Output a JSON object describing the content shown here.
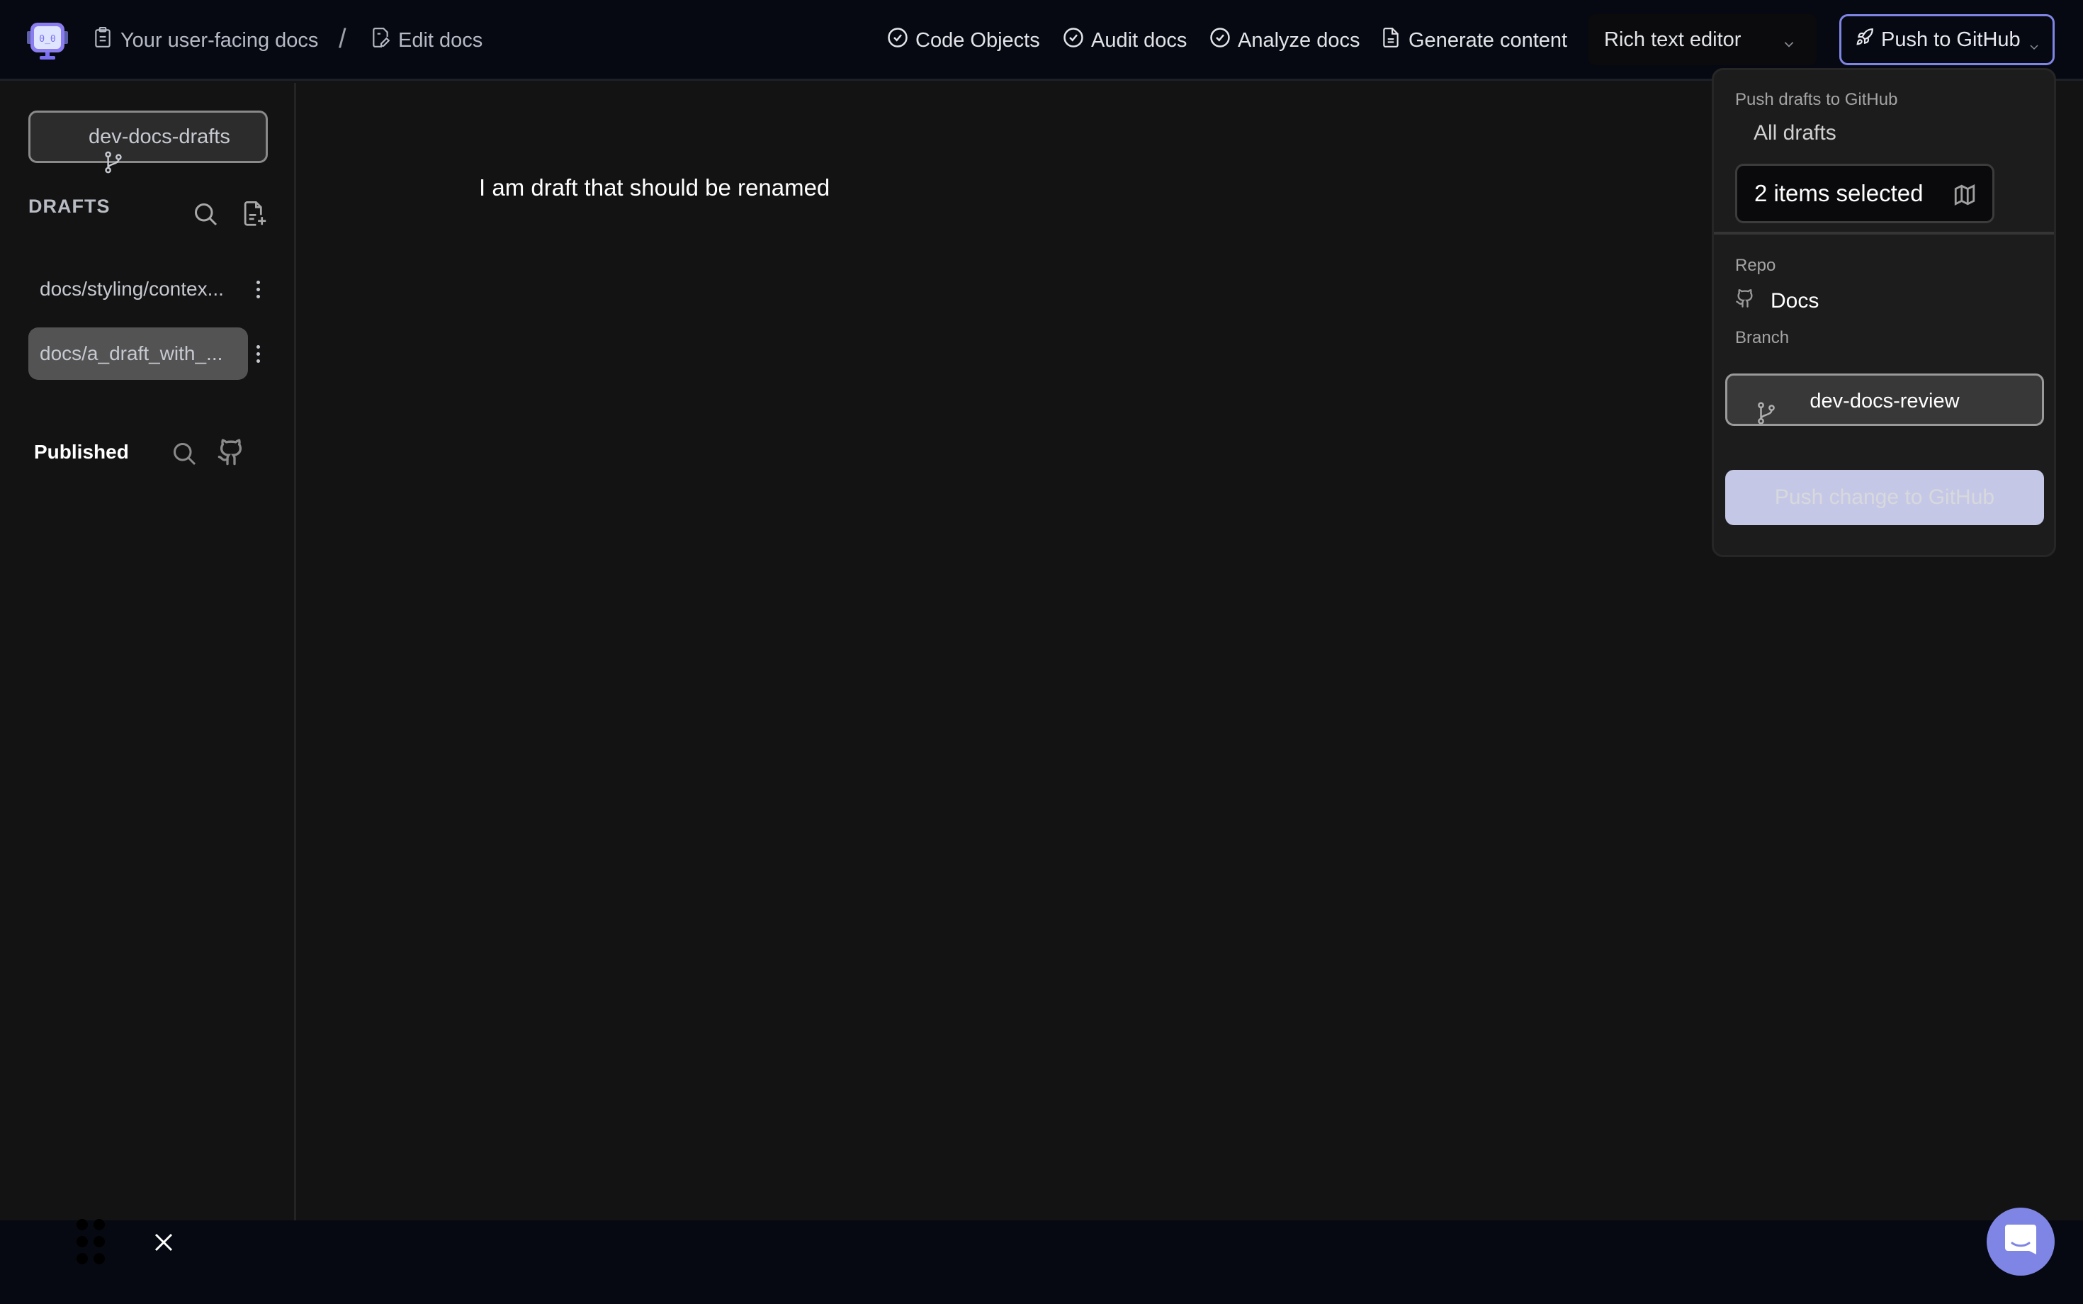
{
  "header": {
    "breadcrumb": [
      {
        "label": "Your user-facing docs",
        "icon": "clipboard-icon"
      },
      {
        "label": "Edit docs",
        "icon": "file-edit-icon"
      }
    ],
    "separator": "/",
    "nav": [
      {
        "label": "Code Objects",
        "icon": "check-circle-icon"
      },
      {
        "label": "Audit docs",
        "icon": "check-circle-icon"
      },
      {
        "label": "Analyze docs",
        "icon": "check-circle-icon"
      },
      {
        "label": "Generate content",
        "icon": "file-text-icon"
      }
    ],
    "editor_mode": "Rich text editor",
    "push_button": "Push to GitHub"
  },
  "sidebar": {
    "branch": "dev-docs-drafts",
    "drafts_title": "DRAFTS",
    "drafts": [
      {
        "label": "docs/styling/contex...",
        "active": false
      },
      {
        "label": "docs/a_draft_with_...",
        "active": true
      }
    ],
    "published_title": "Published"
  },
  "editor": {
    "content": "I am draft that should be renamed"
  },
  "push_popover": {
    "title": "Push drafts to GitHub",
    "scope": "All drafts",
    "selection": "2 items selected",
    "repo_label": "Repo",
    "repo": "Docs",
    "branch_label": "Branch",
    "branch": "dev-docs-review",
    "submit": "Push change to GitHub"
  },
  "colors": {
    "accent": "#7f85e4",
    "topbar_bg": "#060912",
    "main_bg": "#131313",
    "popover_bg": "#1c1c1c",
    "disabled_button": "#c5c7e7"
  }
}
